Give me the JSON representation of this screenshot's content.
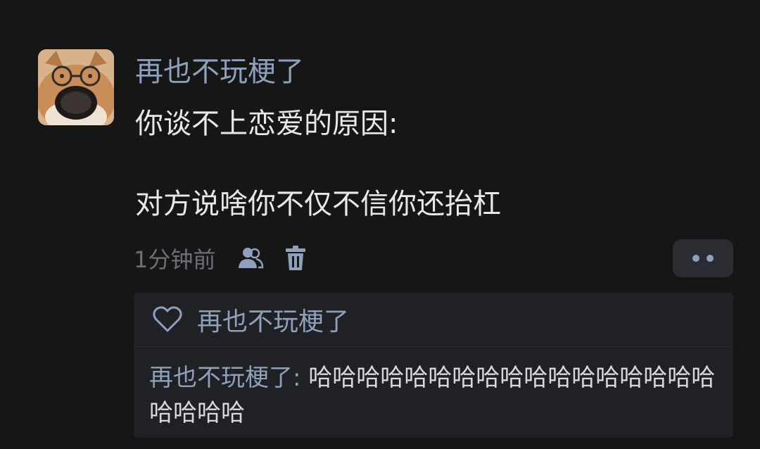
{
  "comment": {
    "username": "再也不玩梗了",
    "content_line1": "你谈不上恋爱的原因:",
    "content_line2": "对方说啥你不仅不信你还抬杠",
    "timestamp": "1分钟前",
    "icons": [
      "users-icon",
      "trash-icon",
      "more-dots-icon"
    ]
  },
  "likes": {
    "icon": "heart-outline-icon",
    "liker": "再也不玩梗了"
  },
  "reply": {
    "author": "再也不玩梗了:",
    "text": " 哈哈哈哈哈哈哈哈哈哈哈哈哈哈哈哈哈哈哈哈哈"
  },
  "colors": {
    "background": "#161617",
    "link_blue": "#8fa0bd",
    "text": "#e8e8ea",
    "muted": "#6c6f76",
    "reply_panel": "#202124"
  }
}
